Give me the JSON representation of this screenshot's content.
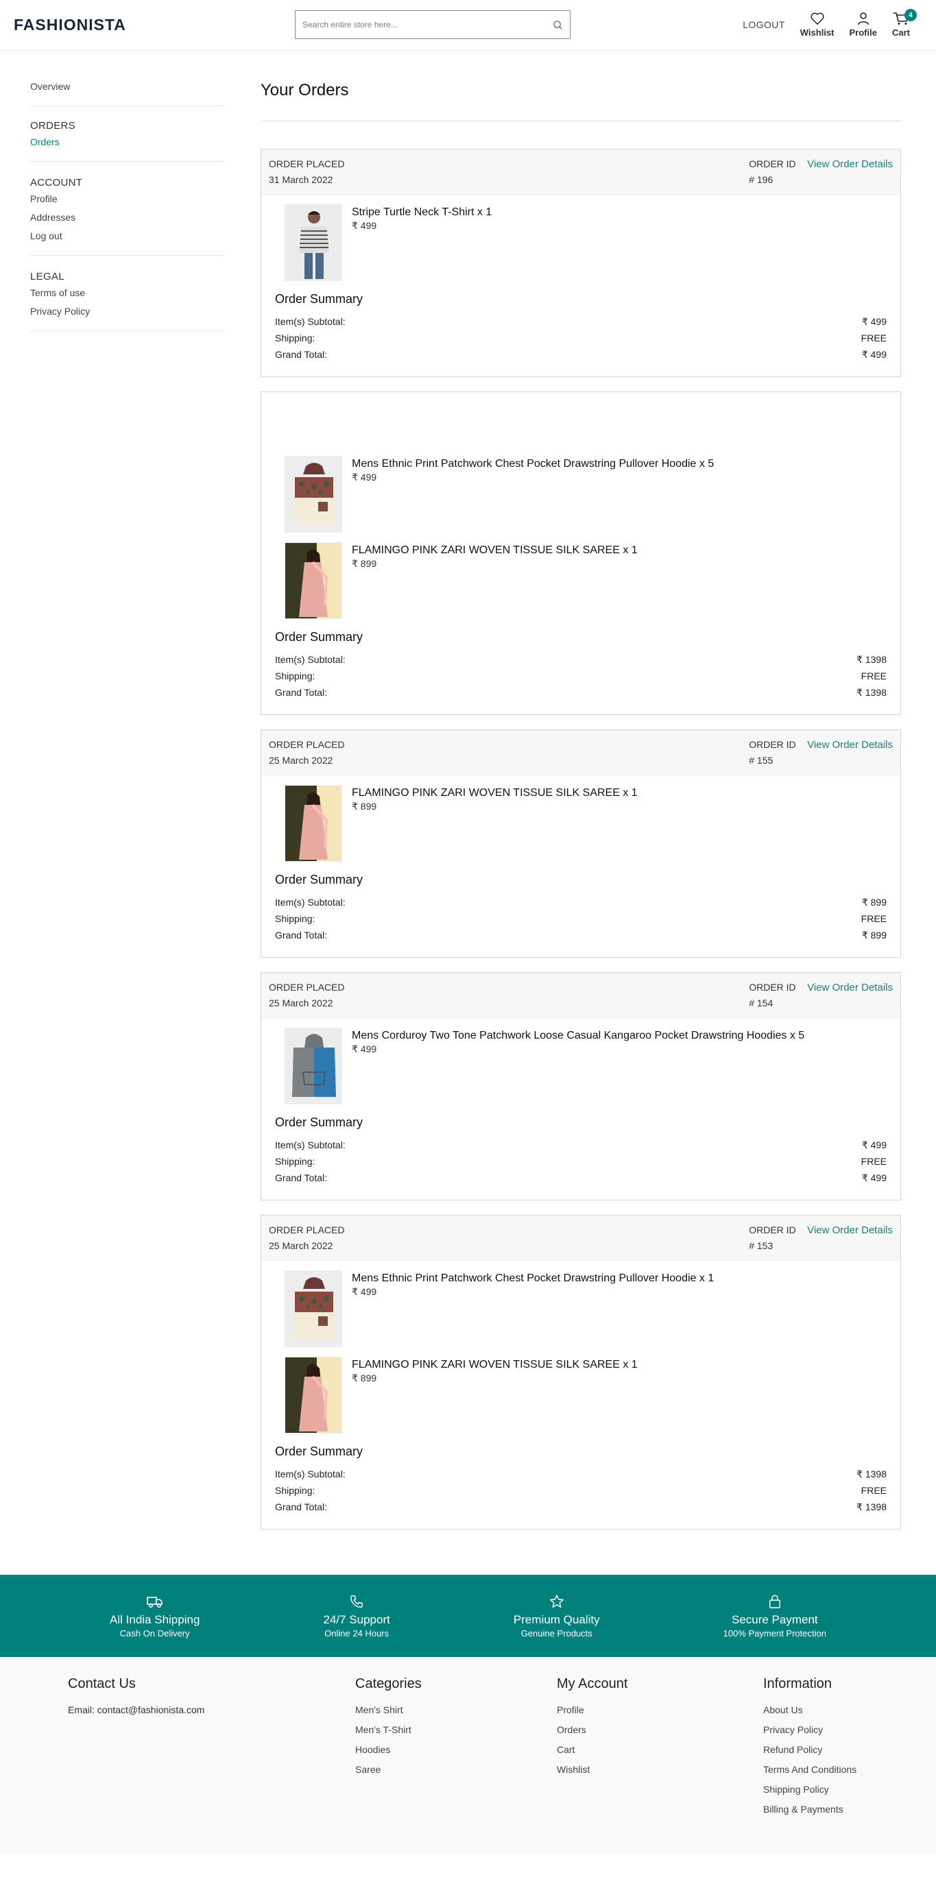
{
  "header": {
    "logo": "FASHIONISTA",
    "search_placeholder": "Search entire store here...",
    "logout": "LOGOUT",
    "wishlist": "Wishlist",
    "profile": "Profile",
    "cart": "Cart",
    "cart_count": "4"
  },
  "sidebar": {
    "overview": "Overview",
    "orders_head": "ORDERS",
    "orders": "Orders",
    "account_head": "ACCOUNT",
    "profile": "Profile",
    "addresses": "Addresses",
    "logout": "Log out",
    "legal_head": "LEGAL",
    "terms": "Terms of use",
    "privacy": "Privacy Policy"
  },
  "main": {
    "title": "Your Orders",
    "labels": {
      "order_placed": "ORDER PLACED",
      "order_id": "ORDER ID",
      "view_details": "View Order Details",
      "summary": "Order Summary",
      "subtotal": "Item(s) Subtotal:",
      "shipping": "Shipping:",
      "grand_total": "Grand Total:"
    },
    "orders": [
      {
        "date": "31 March 2022",
        "id": "# 196",
        "items": [
          {
            "name": "Stripe Turtle Neck T-Shirt x 1",
            "price": "₹ 499",
            "image": "striped-tshirt"
          }
        ],
        "subtotal": "₹ 499",
        "shipping": "FREE",
        "total": "₹ 499"
      },
      {
        "date": "",
        "id": "",
        "items": [
          {
            "name": "Mens Ethnic Print Patchwork Chest Pocket Drawstring Pullover Hoodie x 5",
            "price": "₹ 499",
            "image": "ethnic-hoodie"
          },
          {
            "name": "FLAMINGO PINK ZARI WOVEN TISSUE SILK SAREE x 1",
            "price": "₹ 899",
            "image": "pink-saree"
          }
        ],
        "subtotal": "₹ 1398",
        "shipping": "FREE",
        "total": "₹ 1398"
      },
      {
        "date": "25 March 2022",
        "id": "# 155",
        "items": [
          {
            "name": "FLAMINGO PINK ZARI WOVEN TISSUE SILK SAREE x 1",
            "price": "₹ 899",
            "image": "pink-saree"
          }
        ],
        "subtotal": "₹ 899",
        "shipping": "FREE",
        "total": "₹ 899"
      },
      {
        "date": "25 March 2022",
        "id": "# 154",
        "items": [
          {
            "name": "Mens Corduroy Two Tone Patchwork Loose Casual Kangaroo Pocket Drawstring Hoodies x 5",
            "price": "₹ 499",
            "image": "two-tone-hoodie"
          }
        ],
        "subtotal": "₹ 499",
        "shipping": "FREE",
        "total": "₹ 499"
      },
      {
        "date": "25 March 2022",
        "id": "# 153",
        "items": [
          {
            "name": "Mens Ethnic Print Patchwork Chest Pocket Drawstring Pullover Hoodie x 1",
            "price": "₹ 499",
            "image": "ethnic-hoodie"
          },
          {
            "name": "FLAMINGO PINK ZARI WOVEN TISSUE SILK SAREE x 1",
            "price": "₹ 899",
            "image": "pink-saree"
          }
        ],
        "subtotal": "₹ 1398",
        "shipping": "FREE",
        "total": "₹ 1398"
      }
    ]
  },
  "banner": [
    {
      "title": "All India Shipping",
      "sub": "Cash On Delivery",
      "icon": "truck-icon"
    },
    {
      "title": "24/7 Support",
      "sub": "Online 24 Hours",
      "icon": "phone-icon"
    },
    {
      "title": "Premium Quality",
      "sub": "Genuine Products",
      "icon": "star-icon"
    },
    {
      "title": "Secure Payment",
      "sub": "100% Payment Protection",
      "icon": "lock-icon"
    }
  ],
  "footer": {
    "contact": {
      "title": "Contact Us",
      "email": "Email: contact@fashionista.com"
    },
    "categories": {
      "title": "Categories",
      "links": [
        "Men's Shirt",
        "Men's T-Shirt",
        "Hoodies",
        "Saree"
      ]
    },
    "account": {
      "title": "My Account",
      "links": [
        "Profile",
        "Orders",
        "Cart",
        "Wishlist"
      ]
    },
    "info": {
      "title": "Information",
      "links": [
        "About Us",
        "Privacy Policy",
        "Refund Policy",
        "Terms And Conditions",
        "Shipping Policy",
        "Billing & Payments"
      ]
    }
  },
  "colors": {
    "accent": "#00807a",
    "link": "#1e7e78",
    "text": "#1e1e1e"
  }
}
